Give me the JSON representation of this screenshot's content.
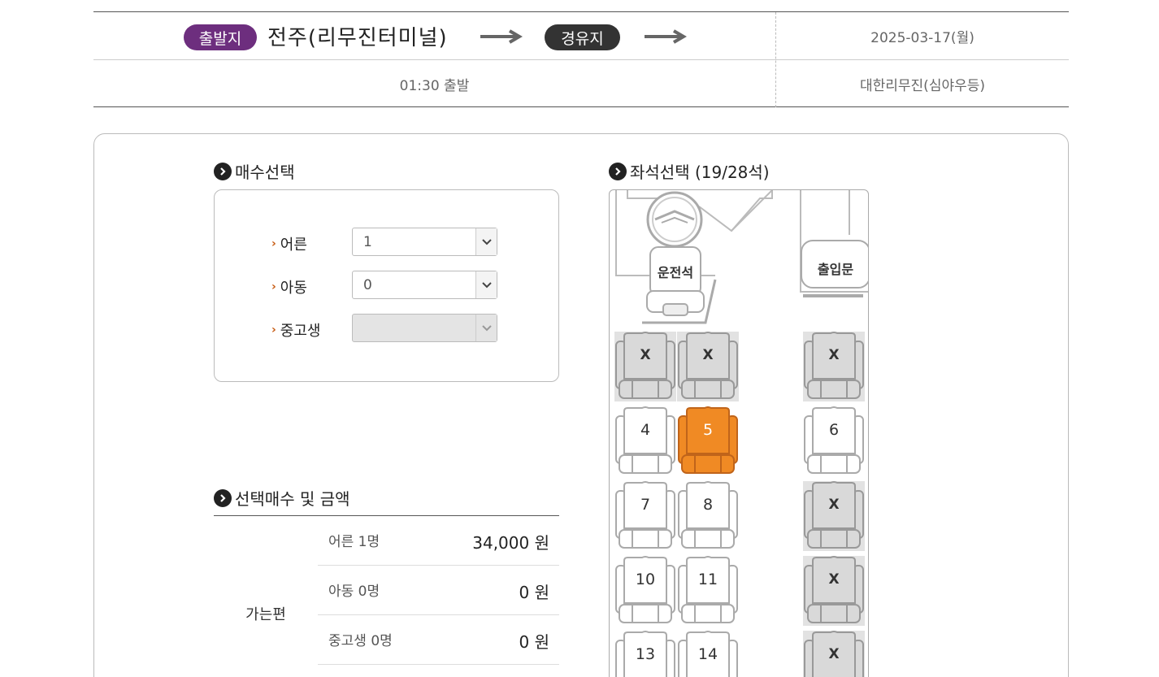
{
  "route": {
    "origin_badge": "출발지",
    "origin_name": "전주(리무진터미널)",
    "via_badge": "경유지",
    "date": "2025-03-17(월)",
    "time": "01:30 출발",
    "company": "대한리무진(심야우등)"
  },
  "quantity": {
    "title": "매수선택",
    "rows": [
      {
        "label": "어른",
        "value": "1",
        "disabled": false
      },
      {
        "label": "아동",
        "value": "0",
        "disabled": false
      },
      {
        "label": "중고생",
        "value": "",
        "disabled": true
      }
    ]
  },
  "seats": {
    "title": "좌석선택 (19/28석)",
    "driver_label": "운전석",
    "door_label": "출입문",
    "taken_mark": "X",
    "list": [
      {
        "label": "X",
        "state": "taken"
      },
      {
        "label": "X",
        "state": "taken"
      },
      {
        "label": "X",
        "state": "taken"
      },
      {
        "label": "4",
        "state": "available"
      },
      {
        "label": "5",
        "state": "selected"
      },
      {
        "label": "6",
        "state": "available"
      },
      {
        "label": "7",
        "state": "available"
      },
      {
        "label": "8",
        "state": "available"
      },
      {
        "label": "X",
        "state": "taken"
      },
      {
        "label": "10",
        "state": "available"
      },
      {
        "label": "11",
        "state": "available"
      },
      {
        "label": "X",
        "state": "taken"
      },
      {
        "label": "13",
        "state": "available"
      },
      {
        "label": "14",
        "state": "available"
      },
      {
        "label": "X",
        "state": "taken"
      }
    ]
  },
  "price": {
    "title": "선택매수 및 금액",
    "group": "가는편",
    "rows": [
      {
        "label": "어른 1명",
        "value": "34,000 원"
      },
      {
        "label": "아동 0명",
        "value": "0 원"
      },
      {
        "label": "중고생 0명",
        "value": "0 원"
      }
    ]
  },
  "colors": {
    "origin_badge": "#6d2e7e",
    "via_badge": "#333333",
    "selected_seat": "#f08a24",
    "taken_seat": "#d9d9d9",
    "accent_chevron": "#c75b12"
  }
}
